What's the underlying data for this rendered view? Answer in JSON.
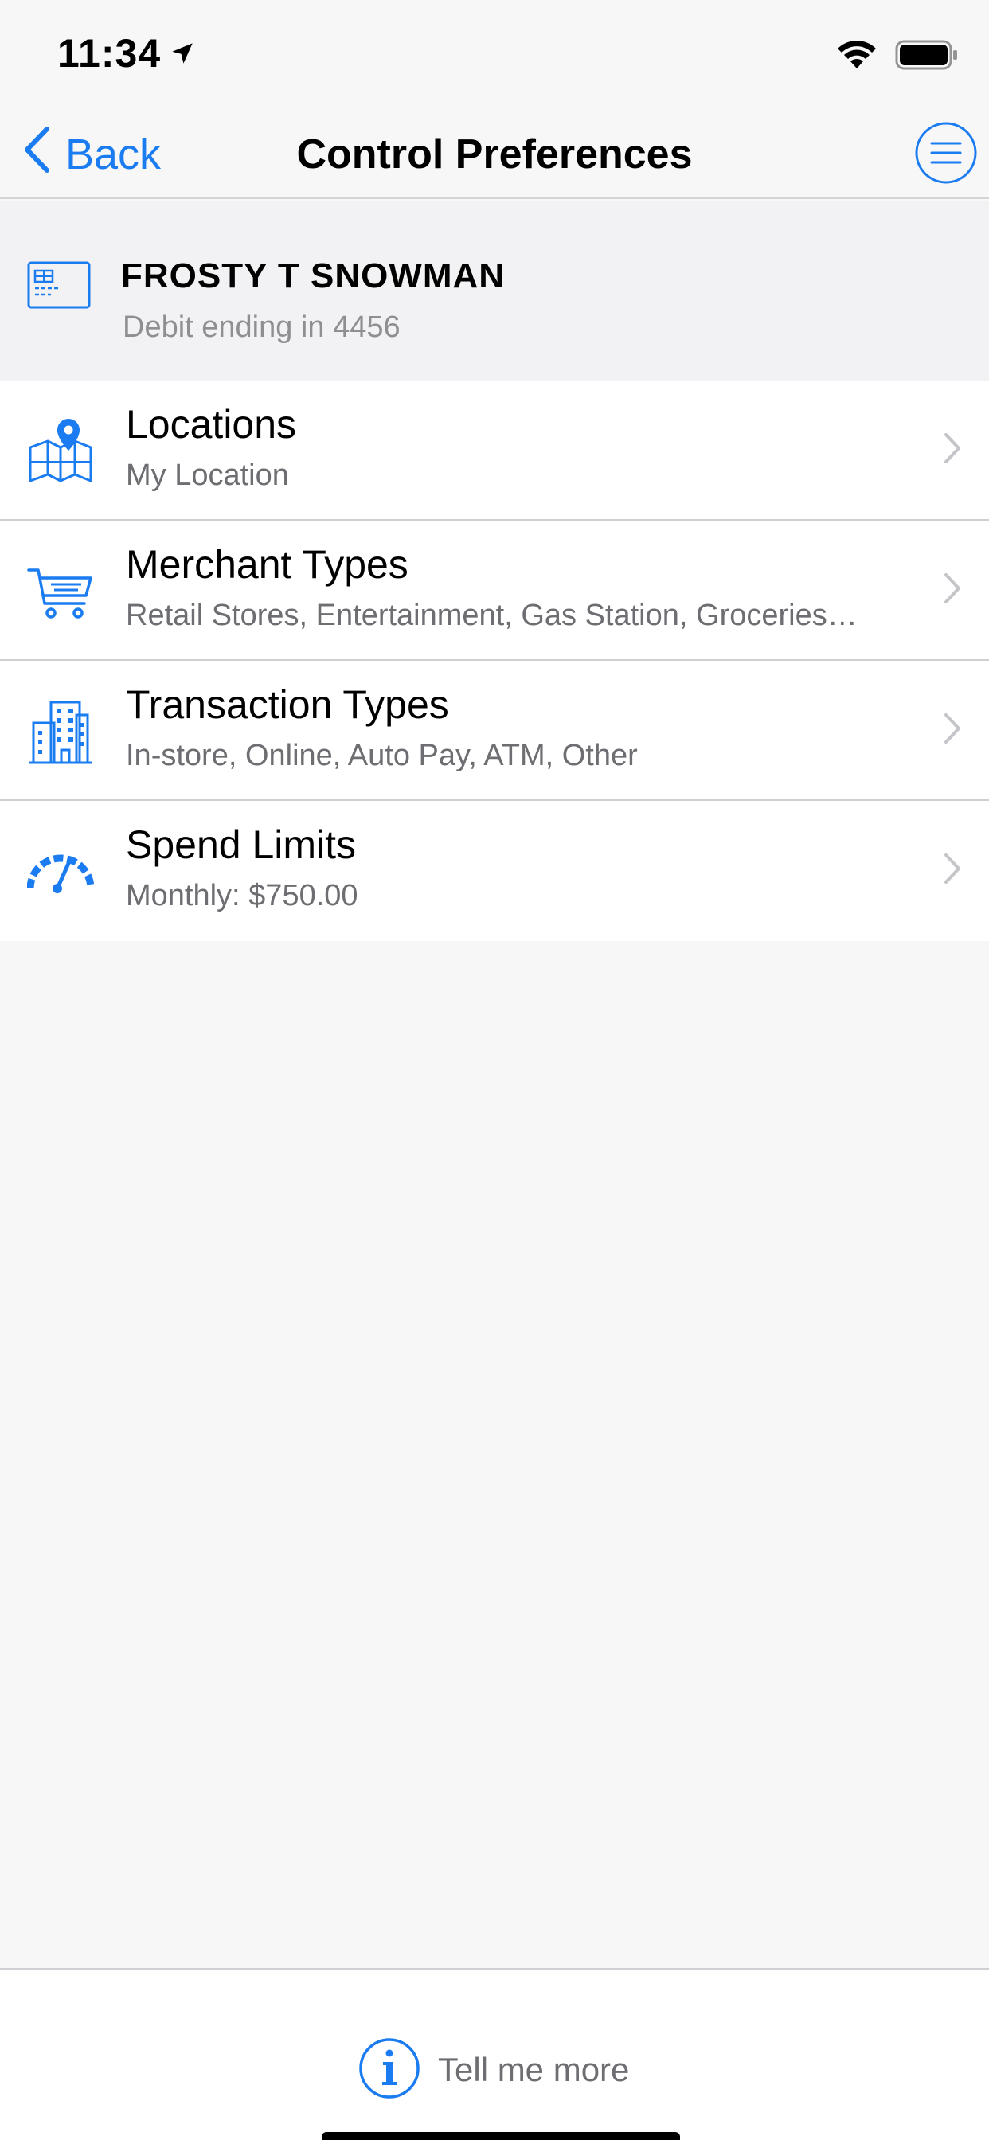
{
  "status_bar": {
    "time": "11:34",
    "location_icon": "location-arrow-icon",
    "wifi_icon": "wifi-icon",
    "battery_icon": "battery-icon"
  },
  "nav": {
    "back_label": "Back",
    "title": "Control Preferences",
    "menu_icon": "hamburger-menu-icon"
  },
  "card": {
    "icon": "credit-card-icon",
    "name": "FROSTY T SNOWMAN",
    "subtitle": "Debit ending in 4456"
  },
  "rows": [
    {
      "icon": "map-pin-icon",
      "title": "Locations",
      "subtitle": "My Location"
    },
    {
      "icon": "shopping-cart-icon",
      "title": "Merchant Types",
      "subtitle": "Retail Stores, Entertainment, Gas Station, Groceries…"
    },
    {
      "icon": "buildings-icon",
      "title": "Transaction Types",
      "subtitle": "In-store, Online, Auto Pay, ATM, Other"
    },
    {
      "icon": "speedometer-icon",
      "title": "Spend Limits",
      "subtitle": "Monthly: $750.00"
    }
  ],
  "footer": {
    "icon": "info-icon",
    "label": "Tell me more"
  },
  "colors": {
    "accent": "#1a7cf0",
    "background": "#f7f7f7",
    "subtext": "#6d6d72",
    "divider": "#d0d0d4"
  }
}
